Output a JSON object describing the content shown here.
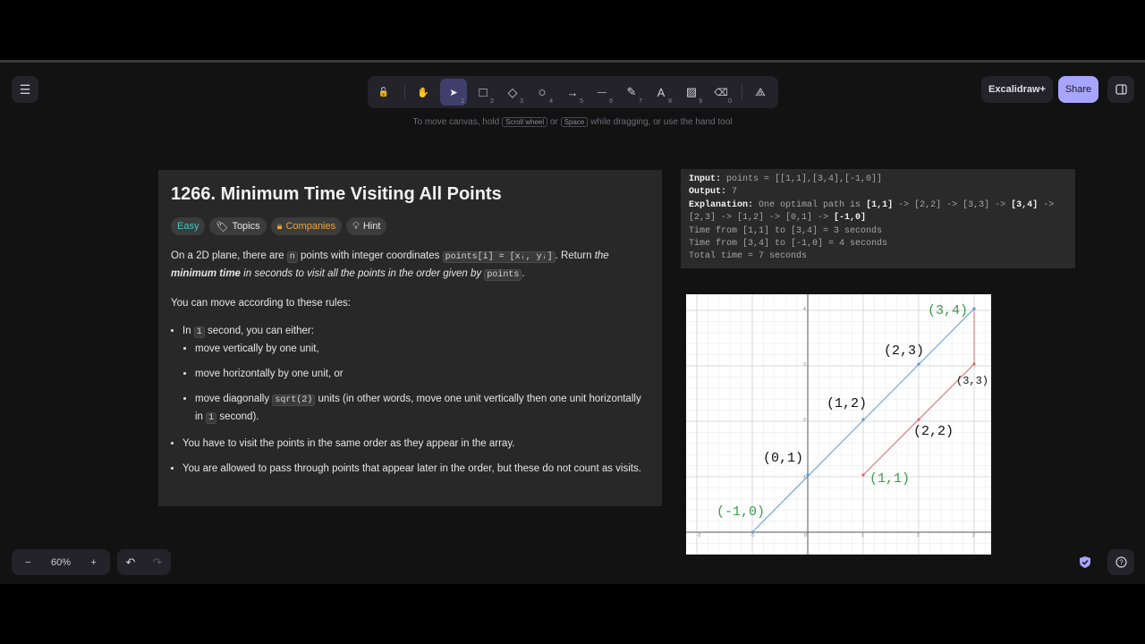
{
  "toolbar": {
    "tools": [
      {
        "name": "lock",
        "glyph": "🔓",
        "num": ""
      },
      {
        "name": "hand",
        "glyph": "✋",
        "num": ""
      },
      {
        "name": "selection",
        "glyph": "➤",
        "num": "1"
      },
      {
        "name": "rectangle",
        "glyph": "□",
        "num": "2"
      },
      {
        "name": "diamond",
        "glyph": "◇",
        "num": "3"
      },
      {
        "name": "ellipse",
        "glyph": "○",
        "num": "4"
      },
      {
        "name": "arrow",
        "glyph": "→",
        "num": "5"
      },
      {
        "name": "line",
        "glyph": "—",
        "num": "6"
      },
      {
        "name": "draw",
        "glyph": "✎",
        "num": "7"
      },
      {
        "name": "text",
        "glyph": "A",
        "num": "8"
      },
      {
        "name": "image",
        "glyph": "▨",
        "num": "9"
      },
      {
        "name": "eraser",
        "glyph": "⌫",
        "num": "0"
      },
      {
        "name": "extra-tools",
        "glyph": "⟁",
        "num": ""
      }
    ]
  },
  "hint": {
    "pre": "To move canvas, hold",
    "key1": "Scroll wheel",
    "mid": "or",
    "key2": "Space",
    "post": "while dragging, or use the hand tool"
  },
  "top_right": {
    "excalidraw_plus": "Excalidraw+",
    "share": "Share"
  },
  "zoom": {
    "minus": "−",
    "level": "60%",
    "plus": "+"
  },
  "history": {
    "undo": "↶",
    "redo": "↷"
  },
  "icons": {
    "menu": "hamburger-menu",
    "library": "sidebar-toggle",
    "help": "help",
    "shield": "shield-check"
  },
  "accent_color": "#a8a5ff",
  "problem": {
    "title": "1266. Minimum Time Visiting All Points",
    "tags": {
      "easy": "Easy",
      "topics": "Topics",
      "companies": "Companies",
      "hint": "Hint"
    },
    "p1": {
      "a": "On a 2D plane, there are",
      "n": "n",
      "b": "points with integer coordinates",
      "code": "points[i] = [xᵢ, yᵢ]",
      "c": ". Return",
      "d": "the",
      "e": "minimum time",
      "f": "in seconds to visit all the points in the order given by",
      "g": "points",
      "h": "."
    },
    "p2": "You can move according to these rules:",
    "rule1": {
      "a": "In",
      "code": "1",
      "b": "second, you can either:"
    },
    "sub1": "move vertically by one unit,",
    "sub2": "move horizontally by one unit, or",
    "sub3": {
      "a": "move diagonally",
      "code": "sqrt(2)",
      "b": "units (in other words, move one unit vertically then one unit horizontally in",
      "code2": "1",
      "c": "second)."
    },
    "rule2": "You have to visit the points in the same order as they appear in the array.",
    "rule3": "You are allowed to pass through points that appear later in the order, but these do not count as visits."
  },
  "example": {
    "input_label": "Input:",
    "input_value": "points = [[1,1],[3,4],[-1,0]]",
    "output_label": "Output:",
    "output_value": "7",
    "expl_label": "Explanation:",
    "expl_a": "One optimal path is",
    "p1": "[1,1]",
    "arrow1": "-> [2,2] -> [3,3] ->",
    "p2": "[3,4]",
    "arrow2": "->",
    "line2": "[2,3] -> [1,2] -> [0,1] ->",
    "p3": "[-1,0]",
    "line3": "Time from [1,1] to [3,4] = 3 seconds",
    "line4": "Time from [3,4] to [-1,0] = 4 seconds",
    "line5": "Total time = 7 seconds"
  },
  "graph": {
    "tick_labels_x": [
      "-2",
      "-1",
      "0",
      "1",
      "2",
      "3"
    ],
    "tick_labels_y": [
      "1",
      "2",
      "3",
      "4"
    ],
    "labels": {
      "p_3_4": "(3,4)",
      "p_2_3": "(2,3)",
      "p_3_3": "(3,3)",
      "p_1_2": "(1,2)",
      "p_2_2": "(2,2)",
      "p_0_1": "(0,1)",
      "p_1_1": "(1,1)",
      "p_m1_0": "(-1,0)"
    },
    "colors": {
      "blue_path": "#5b9bd5",
      "red_path": "#e06666",
      "green_label": "#3a9a4a"
    }
  }
}
